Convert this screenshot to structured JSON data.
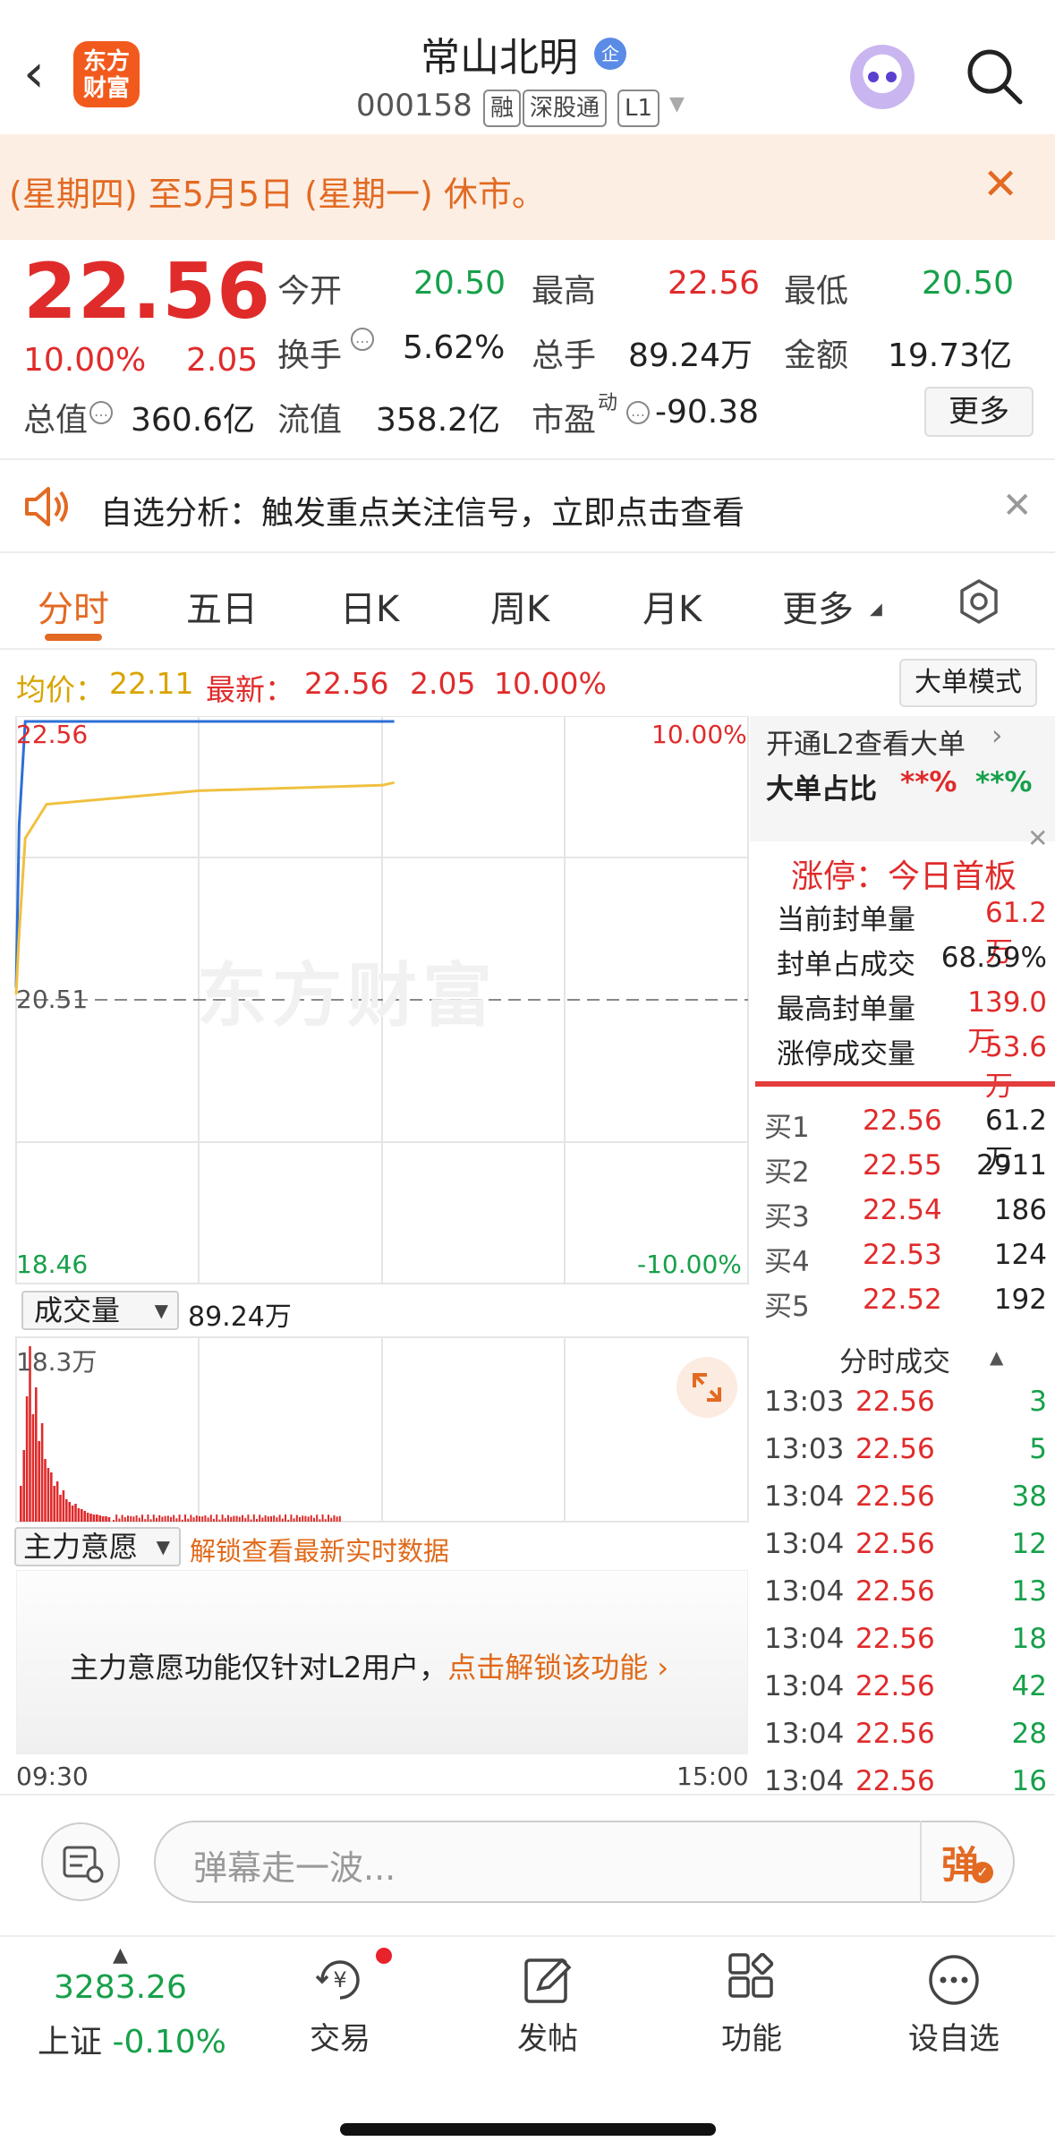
{
  "header": {
    "back": "‹",
    "logo_line1": "东方",
    "logo_line2": "财富",
    "stock_name": "常山北明",
    "name_badge": "企",
    "stock_code": "000158",
    "tags": [
      "融",
      "深股通",
      "L1"
    ]
  },
  "notice": {
    "text": "(星期四) 至5月5日 (星期一) 休市。"
  },
  "quote": {
    "price": "22.56",
    "change_pct": "10.00%",
    "change_amt": "2.05",
    "total_value_label": "总值",
    "total_value": "360.6亿",
    "open_label": "今开",
    "open": "20.50",
    "high_label": "最高",
    "high": "22.56",
    "low_label": "最低",
    "low": "20.50",
    "turnover_label": "换手",
    "turnover": "5.62%",
    "volume_label": "总手",
    "volume": "89.24万",
    "amount_label": "金额",
    "amount": "19.73亿",
    "float_label": "流值",
    "float_value": "358.2亿",
    "pe_label": "市盈",
    "pe_sup": "动",
    "pe": "-90.38",
    "more": "更多"
  },
  "alert": {
    "text": "自选分析：触发重点关注信号，立即点击查看"
  },
  "tabs": [
    "分时",
    "五日",
    "日K",
    "周K",
    "月K",
    "更多"
  ],
  "strip": {
    "avg_label": "均价：",
    "avg": "22.11",
    "latest_label": "最新：",
    "latest": "22.56",
    "chg": "2.05",
    "pct": "10.00%",
    "big_mode": "大单模式"
  },
  "intraday": {
    "top_price": "22.56",
    "top_pct": "10.00%",
    "mid_price": "20.51",
    "bottom_price": "18.46",
    "bottom_pct": "-10.00%",
    "watermark": "东方财富",
    "vol_selector": "成交量",
    "vol_total": "89.24万",
    "vol_axis": "18.3万",
    "zl_selector": "主力意愿",
    "zl_unlock": "解锁查看最新实时数据",
    "zl_msg": "主力意愿功能仅针对L2用户，",
    "zl_link": "点击解锁该功能",
    "time_start": "09:30",
    "time_end": "15:00"
  },
  "chart_data": {
    "type": "line",
    "ylim": [
      18.46,
      22.56
    ],
    "series": [
      {
        "name": "最新",
        "x": [
          "09:30",
          "09:31",
          "09:33",
          "09:35",
          "13:04"
        ],
        "values": [
          20.6,
          21.8,
          22.56,
          22.56,
          22.56
        ]
      },
      {
        "name": "均价",
        "x": [
          "09:30",
          "09:31",
          "09:33",
          "09:40",
          "10:30",
          "11:30",
          "13:04"
        ],
        "values": [
          20.55,
          21.0,
          21.7,
          21.95,
          22.05,
          22.09,
          22.11
        ]
      }
    ],
    "volume": {
      "ylim": [
        0,
        18.3
      ],
      "unit": "万"
    }
  },
  "right_panel": {
    "l2_text": "开通L2查看大单",
    "big_ratio_label": "大单占比",
    "big_ratio_a": "**%",
    "big_ratio_b": "**%",
    "limit_title": "涨停：今日首板",
    "limit_rows": [
      {
        "label": "当前封单量",
        "value": "61.2万"
      },
      {
        "label": "封单占成交",
        "value": "68.59%"
      },
      {
        "label": "最高封单量",
        "value": "139.0万"
      },
      {
        "label": "涨停成交量",
        "value": "53.6万"
      }
    ],
    "bids": [
      {
        "label": "买1",
        "price": "22.56",
        "vol": "61.2万"
      },
      {
        "label": "买2",
        "price": "22.55",
        "vol": "2911"
      },
      {
        "label": "买3",
        "price": "22.54",
        "vol": "186"
      },
      {
        "label": "买4",
        "price": "22.53",
        "vol": "124"
      },
      {
        "label": "买5",
        "price": "22.52",
        "vol": "192"
      }
    ],
    "trades_title": "分时成交",
    "trades": [
      {
        "t": "13:03",
        "p": "22.56",
        "v": "3"
      },
      {
        "t": "13:03",
        "p": "22.56",
        "v": "5"
      },
      {
        "t": "13:04",
        "p": "22.56",
        "v": "38"
      },
      {
        "t": "13:04",
        "p": "22.56",
        "v": "12"
      },
      {
        "t": "13:04",
        "p": "22.56",
        "v": "13"
      },
      {
        "t": "13:04",
        "p": "22.56",
        "v": "18"
      },
      {
        "t": "13:04",
        "p": "22.56",
        "v": "42"
      },
      {
        "t": "13:04",
        "p": "22.56",
        "v": "28"
      },
      {
        "t": "13:04",
        "p": "22.56",
        "v": "16"
      }
    ]
  },
  "comment": {
    "placeholder": "弹幕走一波...",
    "send": "弹"
  },
  "nav": {
    "index_value": "3283.26",
    "index_name": "上证",
    "index_pct": "-0.10%",
    "items": [
      "交易",
      "发帖",
      "功能",
      "设自选"
    ]
  },
  "colors": {
    "up": "#e02b2b",
    "down": "#16a04a",
    "accent": "#e26a23",
    "price_line": "#2d6fd6",
    "avg_line": "#f0c040"
  }
}
